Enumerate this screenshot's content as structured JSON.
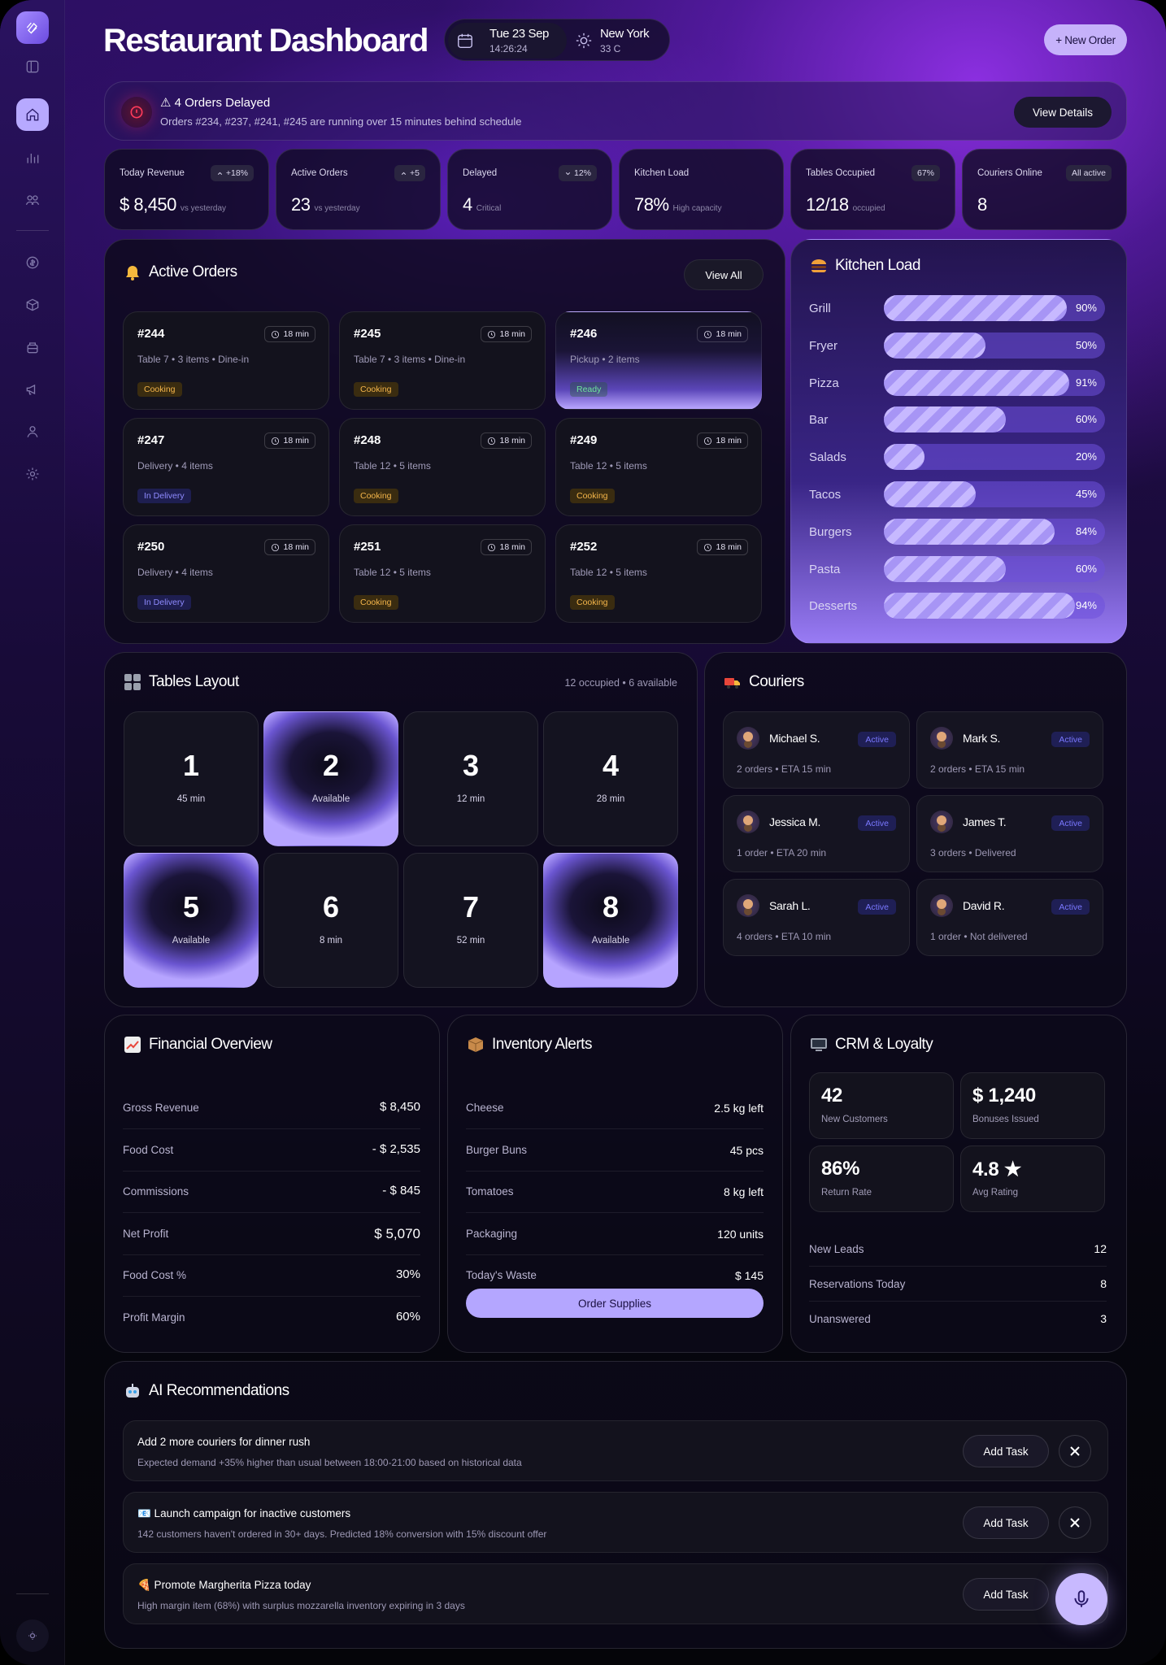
{
  "header": {
    "title": "Restaurant Dashboard",
    "date": "Tue 23 Sep",
    "time": "14:26:24",
    "city": "New York",
    "temp": "33 C",
    "new_order": "+ New Order"
  },
  "alert": {
    "title": "⚠ 4 Orders Delayed",
    "text": "Orders #234, #237, #241, #245 are running over 15 minutes behind schedule",
    "button": "View Details"
  },
  "stats": [
    {
      "label": "Today Revenue",
      "badge": "+18%",
      "badge_icon": "chevron-up",
      "value": "$ 8,450",
      "sub": "vs yesterday"
    },
    {
      "label": "Active Orders",
      "badge": "+5",
      "badge_icon": "chevron-up",
      "value": "23",
      "sub": "vs yesterday"
    },
    {
      "label": "Delayed",
      "badge": "12%",
      "badge_icon": "chevron-down",
      "value": "4",
      "sub": "Critical"
    },
    {
      "label": "Kitchen Load",
      "badge": "",
      "value": "78%",
      "sub": "High capacity"
    },
    {
      "label": "Tables Occupied",
      "badge": "67%",
      "value": "12/18",
      "sub": "occupied"
    },
    {
      "label": "Couriers Online",
      "badge": "All active",
      "value": "8",
      "sub": ""
    }
  ],
  "active_orders": {
    "title": "Active Orders",
    "view_all": "View All",
    "orders": [
      {
        "id": "#244",
        "time": "18 min",
        "desc": "Table 7 • 3 items • Dine-in",
        "status": "Cooking",
        "kind": "cooking"
      },
      {
        "id": "#245",
        "time": "18 min",
        "desc": "Table 7 • 3 items • Dine-in",
        "status": "Cooking",
        "kind": "cooking"
      },
      {
        "id": "#246",
        "time": "18 min",
        "desc": "Pickup • 2 items",
        "status": "Ready",
        "kind": "ready"
      },
      {
        "id": "#247",
        "time": "18 min",
        "desc": "Delivery • 4 items",
        "status": "In Delivery",
        "kind": "delivery"
      },
      {
        "id": "#248",
        "time": "18 min",
        "desc": "Table 12 • 5 items",
        "status": "Cooking",
        "kind": "cooking"
      },
      {
        "id": "#249",
        "time": "18 min",
        "desc": "Table 12 • 5 items",
        "status": "Cooking",
        "kind": "cooking"
      },
      {
        "id": "#250",
        "time": "18 min",
        "desc": "Delivery • 4 items",
        "status": "In Delivery",
        "kind": "delivery"
      },
      {
        "id": "#251",
        "time": "18 min",
        "desc": "Table 12 • 5 items",
        "status": "Cooking",
        "kind": "cooking"
      },
      {
        "id": "#252",
        "time": "18 min",
        "desc": "Table 12 • 5 items",
        "status": "Cooking",
        "kind": "cooking"
      }
    ]
  },
  "kitchen": {
    "title": "Kitchen Load",
    "stations": [
      {
        "name": "Grill",
        "pct": 90,
        "label": "90%"
      },
      {
        "name": "Fryer",
        "pct": 50,
        "label": "50%"
      },
      {
        "name": "Pizza",
        "pct": 91,
        "label": "91%"
      },
      {
        "name": "Bar",
        "pct": 60,
        "label": "60%"
      },
      {
        "name": "Salads",
        "pct": 20,
        "label": "20%"
      },
      {
        "name": "Tacos",
        "pct": 45,
        "label": "45%"
      },
      {
        "name": "Burgers",
        "pct": 84,
        "label": "84%"
      },
      {
        "name": "Pasta",
        "pct": 60,
        "label": "60%"
      },
      {
        "name": "Desserts",
        "pct": 94,
        "label": "94%"
      }
    ]
  },
  "tables": {
    "title": "Tables Layout",
    "summary": "12 occupied • 6 available",
    "items": [
      {
        "num": "1",
        "sub": "45 min",
        "available": false
      },
      {
        "num": "2",
        "sub": "Available",
        "available": true
      },
      {
        "num": "3",
        "sub": "12 min",
        "available": false
      },
      {
        "num": "4",
        "sub": "28 min",
        "available": false
      },
      {
        "num": "5",
        "sub": "Available",
        "available": true
      },
      {
        "num": "6",
        "sub": "8 min",
        "available": false
      },
      {
        "num": "7",
        "sub": "52 min",
        "available": false
      },
      {
        "num": "8",
        "sub": "Available",
        "available": true
      }
    ]
  },
  "couriers": {
    "title": "Couriers",
    "items": [
      {
        "name": "Michael S.",
        "status": "Active",
        "detail": "2 orders • ETA 15 min"
      },
      {
        "name": "Mark S.",
        "status": "Active",
        "detail": "2 orders • ETA 15 min"
      },
      {
        "name": "Jessica M.",
        "status": "Active",
        "detail": "1 order • ETA 20 min"
      },
      {
        "name": "James T.",
        "status": "Active",
        "detail": "3 orders • Delivered"
      },
      {
        "name": "Sarah L.",
        "status": "Active",
        "detail": "4 orders • ETA 10 min"
      },
      {
        "name": "David R.",
        "status": "Active",
        "detail": "1 order • Not delivered"
      }
    ]
  },
  "financial": {
    "title": "Financial Overview",
    "rows": [
      {
        "label": "Gross Revenue",
        "value": "$ 8,450"
      },
      {
        "label": "Food Cost",
        "value": "- $ 2,535"
      },
      {
        "label": "Commissions",
        "value": "- $ 845"
      },
      {
        "label": "Net Profit",
        "value": "$ 5,070"
      },
      {
        "label": "Food Cost %",
        "value": "30%"
      },
      {
        "label": "Profit Margin",
        "value": "60%"
      }
    ]
  },
  "inventory": {
    "title": "Inventory Alerts",
    "rows": [
      {
        "label": "Cheese",
        "value": "2.5 kg left"
      },
      {
        "label": "Burger Buns",
        "value": "45 pcs"
      },
      {
        "label": "Tomatoes",
        "value": "8 kg left"
      },
      {
        "label": "Packaging",
        "value": "120 units"
      },
      {
        "label": "Today's Waste",
        "value": "$ 145"
      }
    ],
    "button": "Order Supplies"
  },
  "crm": {
    "title": "CRM & Loyalty",
    "cards": [
      {
        "value": "42",
        "label": "New Customers"
      },
      {
        "value": "$ 1,240",
        "label": "Bonuses Issued"
      },
      {
        "value": "86%",
        "label": "Return Rate"
      },
      {
        "value": "4.8 ★",
        "label": "Avg Rating"
      }
    ],
    "rows": [
      {
        "label": "New Leads",
        "value": "12"
      },
      {
        "label": "Reservations Today",
        "value": "8"
      },
      {
        "label": "Unanswered",
        "value": "3"
      }
    ]
  },
  "ai": {
    "title": "AI Recommendations",
    "items": [
      {
        "title": "Add 2 more couriers for dinner rush",
        "desc": "Expected demand +35% higher than usual between 18:00-21:00 based on historical data",
        "button": "Add Task"
      },
      {
        "title": "📧 Launch campaign for inactive customers",
        "desc": "142 customers haven't ordered in 30+ days. Predicted 18% conversion with 15% discount offer",
        "button": "Add Task"
      },
      {
        "title": "🍕 Promote Margherita Pizza today",
        "desc": "High margin item (68%) with surplus mozzarella inventory expiring in 3 days",
        "button": "Add Task"
      }
    ]
  }
}
